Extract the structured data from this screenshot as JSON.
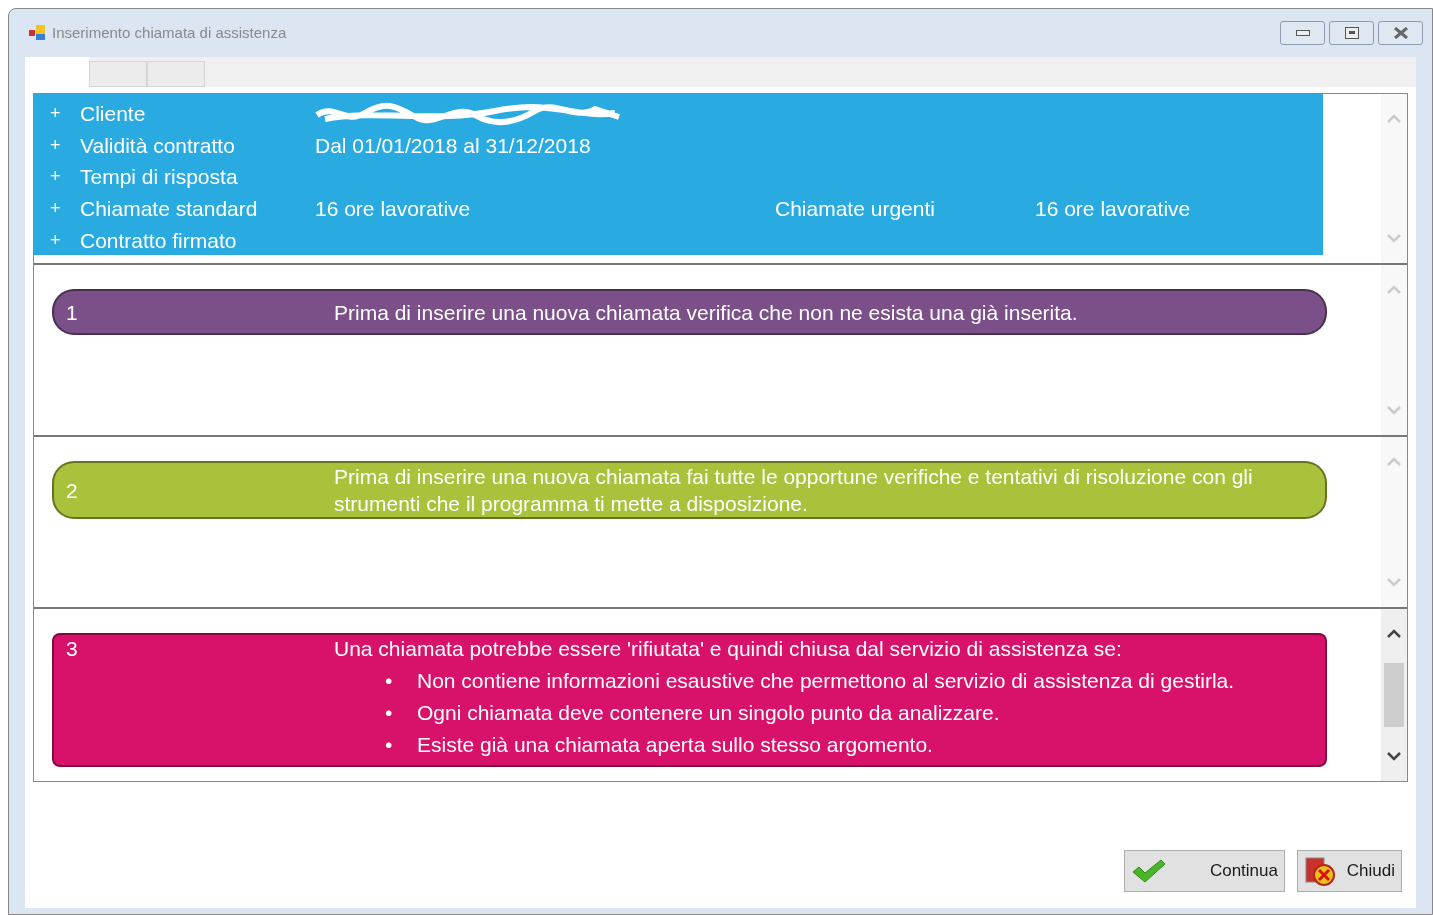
{
  "window": {
    "title": "Inserimento chiamata di assistenza"
  },
  "tabs": [
    {
      "selected": true
    },
    {
      "selected": false
    },
    {
      "selected": false
    }
  ],
  "info_panel": {
    "scrollbar_enabled": false,
    "rows": [
      {
        "expander": "+",
        "label": "Cliente",
        "kind": "redacted"
      },
      {
        "expander": "+",
        "label": "Validità contratto",
        "kind": "text",
        "value": "Dal 01/01/2018 al 31/12/2018"
      },
      {
        "expander": "+",
        "label": "Tempi di risposta",
        "kind": "text"
      },
      {
        "expander": "+",
        "label": "Chiamate standard",
        "kind": "text",
        "value": "16 ore lavorative",
        "extra_label": "Chiamate urgenti",
        "extra_value": "16 ore lavorative"
      },
      {
        "expander": "+",
        "label": "Contratto firmato",
        "kind": "text"
      }
    ]
  },
  "notes": [
    {
      "number": "1",
      "color": "#7b5088",
      "scrollbar_enabled": false,
      "text": "Prima di inserire una nuova chiamata verifica che non ne esista una già inserita."
    },
    {
      "number": "2",
      "color": "#a9c23b",
      "scrollbar_enabled": false,
      "text": "Prima di inserire una nuova chiamata fai tutte le opportune verifiche e tentativi di risoluzione con gli strumenti che il programma ti mette a disposizione."
    },
    {
      "number": "3",
      "color": "#d8126b",
      "scrollbar_enabled": true,
      "text": "Una chiamata potrebbe essere 'rifiutata' e quindi chiusa dal servizio di assistenza se:",
      "bullets": [
        {
          "marker": "•",
          "text": "Non contiene informazioni esaustive che permettono al servizio di assistenza di gestirla."
        },
        {
          "marker": "•",
          "text": "Ogni chiamata deve contenere un singolo punto da analizzare."
        },
        {
          "marker": "•",
          "text": "Esiste già una chiamata aperta sullo stesso argomento."
        }
      ]
    }
  ],
  "buttons": [
    {
      "kind": "continue",
      "label": "Continua"
    },
    {
      "kind": "close",
      "label": "Chiudi"
    }
  ]
}
